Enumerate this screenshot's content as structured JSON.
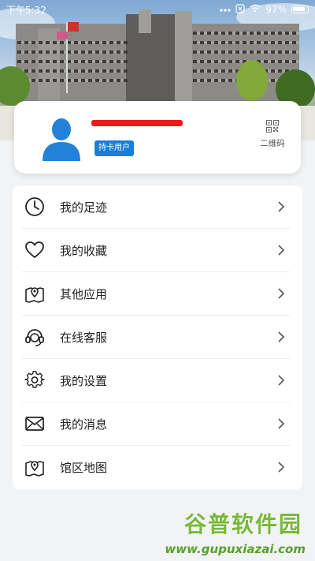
{
  "status_bar": {
    "time": "下午5:32",
    "battery": "97%"
  },
  "profile": {
    "role_badge": "持卡用户",
    "qr_label": "二维码"
  },
  "menu": {
    "items": [
      {
        "label": "我的足迹",
        "icon": "clock-icon"
      },
      {
        "label": "我的收藏",
        "icon": "heart-icon"
      },
      {
        "label": "其他应用",
        "icon": "map-pin-icon"
      },
      {
        "label": "在线客服",
        "icon": "headset-icon"
      },
      {
        "label": "我的设置",
        "icon": "gear-icon"
      },
      {
        "label": "我的消息",
        "icon": "envelope-icon"
      },
      {
        "label": "馆区地图",
        "icon": "map-pin-icon"
      }
    ]
  },
  "watermark": {
    "title": "谷普软件园",
    "url": "www.gupuxiazai.com"
  },
  "colors": {
    "badge_blue": "#1a7fd6",
    "redaction_red": "#f01818",
    "watermark_green": "#79b83a"
  }
}
